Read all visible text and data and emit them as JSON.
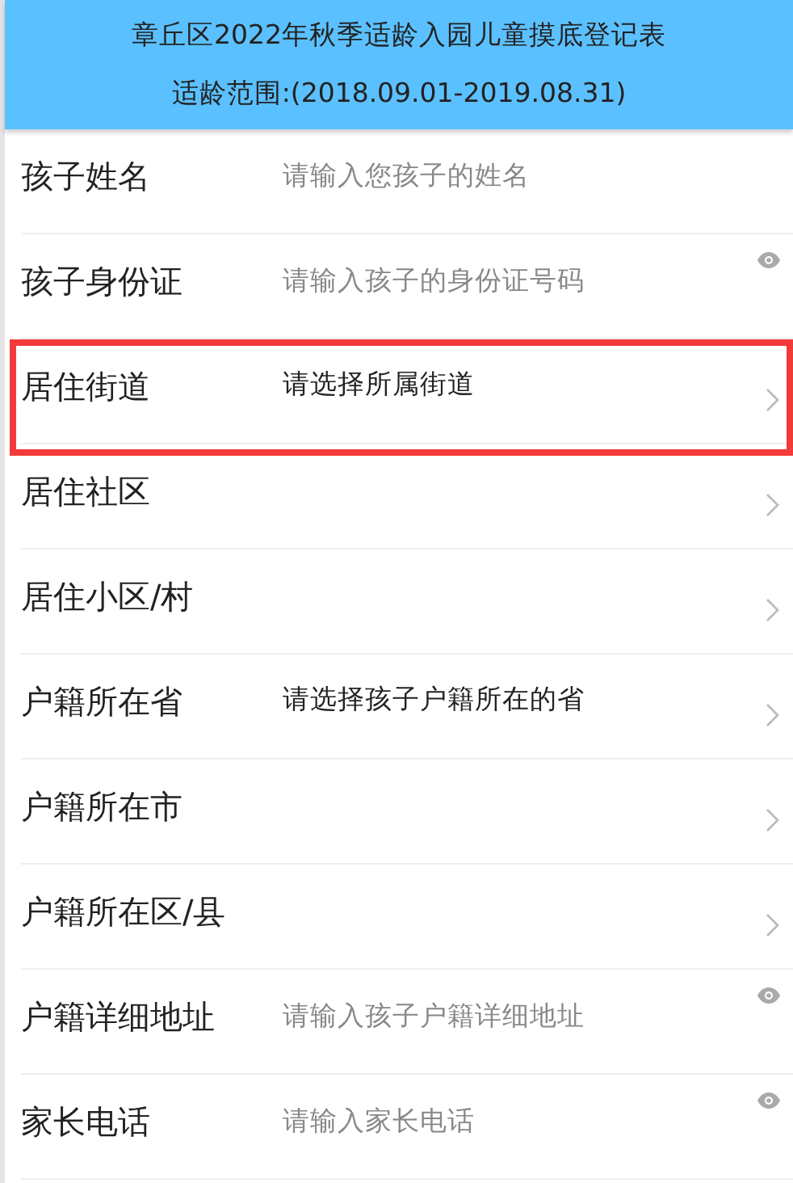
{
  "header": {
    "title": "章丘区2022年秋季适龄入园儿童摸底登记表",
    "subtitle": "适龄范围:(2018.09.01-2019.08.31)"
  },
  "fields": [
    {
      "kind": "input",
      "label": "孩子姓名",
      "placeholder": "请输入您孩子的姓名",
      "eye": false,
      "highlighted": false
    },
    {
      "kind": "input",
      "label": "孩子身份证",
      "placeholder": "请输入孩子的身份证号码",
      "eye": true,
      "highlighted": false
    },
    {
      "kind": "select",
      "label": "居住街道",
      "prompt": "请选择所属街道",
      "highlighted": true
    },
    {
      "kind": "select",
      "label": "居住社区",
      "highlighted": false
    },
    {
      "kind": "select",
      "label": "居住小区/村",
      "highlighted": false
    },
    {
      "kind": "select",
      "label": "户籍所在省",
      "prompt": "请选择孩子户籍所在的省",
      "highlighted": false
    },
    {
      "kind": "select",
      "label": "户籍所在市",
      "highlighted": false
    },
    {
      "kind": "select",
      "label": "户籍所在区/县",
      "highlighted": false
    },
    {
      "kind": "input",
      "label": "户籍详细地址",
      "placeholder": "请输入孩子户籍详细地址",
      "eye": true,
      "highlighted": false
    },
    {
      "kind": "input",
      "label": "家长电话",
      "placeholder": "请输入家长电话",
      "eye": true,
      "highlighted": false
    }
  ]
}
